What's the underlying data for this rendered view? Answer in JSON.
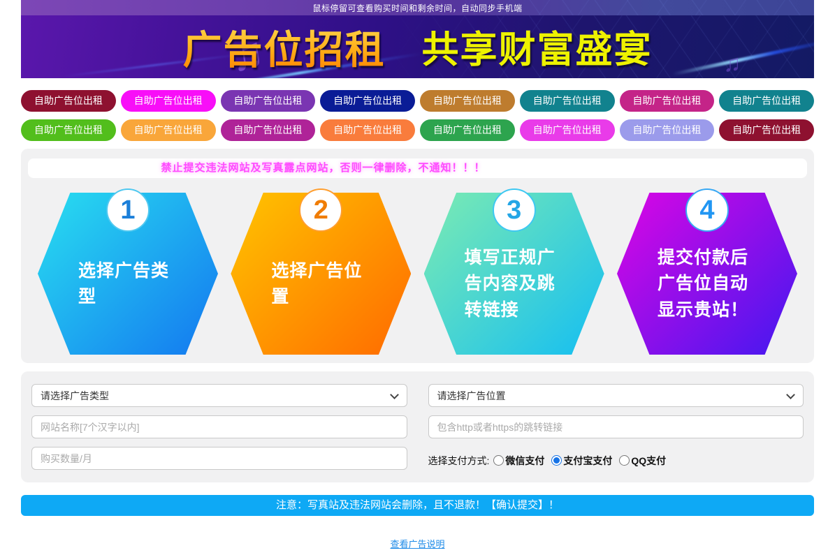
{
  "topbar": {
    "notice": "鼠标停留可查看购买时间和剩余时间，自动同步手机端"
  },
  "banner": {
    "title_main": "广告位招租",
    "title_sub": "共享财富盛宴",
    "music_note_glyph": "♫"
  },
  "ad_buttons": {
    "label": "自助广告位出租",
    "rows": [
      [
        "#8e1130",
        "#f80ef8",
        "#7a35b2",
        "#0a1c96",
        "#be7c2e",
        "#11828e",
        "#c42488",
        "#11828e"
      ],
      [
        "#52be1c",
        "#f9a63a",
        "#af2398",
        "#f97c3c",
        "#2da44e",
        "#e93be9",
        "#9b9beb",
        "#8e1130"
      ]
    ]
  },
  "steps": {
    "warning": "禁止提交违法网站及写真露点网站，否则一律删除，不通知！！！",
    "items": [
      {
        "number": "1",
        "text": "选择广告类型",
        "gradient_start": "#29dff0",
        "gradient_end": "#1377f0",
        "number_color": "#1b7fd9",
        "ring_color": "#4fc8f0"
      },
      {
        "number": "2",
        "text": "选择广告位置",
        "gradient_start": "#ffc400",
        "gradient_end": "#ff6a00",
        "number_color": "#f07d05",
        "ring_color": "#ff9e2e"
      },
      {
        "number": "3",
        "text": "填写正规广告内容及跳转链接",
        "gradient_start": "#7cebb2",
        "gradient_end": "#14bef2",
        "number_color": "#24a6e6",
        "ring_color": "#3ec8f2"
      },
      {
        "number": "4",
        "text": "提交付款后广告位自动显示贵站！",
        "gradient_start": "#dc06e4",
        "gradient_end": "#4218f0",
        "number_color": "#2196f3",
        "ring_color": "#38a8f4"
      }
    ]
  },
  "form": {
    "ad_type_selected": "请选择广告类型",
    "ad_position_selected": "请选择广告位置",
    "site_name_placeholder": "网站名称[7个汉字以内]",
    "link_placeholder": "包含http或者https的跳转链接",
    "quantity_placeholder": "购买数量/月",
    "payment": {
      "label": "选择支付方式:",
      "options": [
        {
          "label": "微信支付",
          "checked": false
        },
        {
          "label": "支付宝支付",
          "checked": true
        },
        {
          "label": "QQ支付",
          "checked": false
        }
      ]
    }
  },
  "footer": {
    "submit_notice": "注意：写真站及违法网站会删除，且不退款！【确认提交】！",
    "help_link": "查看广告说明"
  },
  "colors": {
    "accent_blue": "#0ea9f5",
    "warning_pink": "#ff4bff",
    "link_blue": "#1e8be8",
    "card_gray": "#f1f1f2"
  }
}
